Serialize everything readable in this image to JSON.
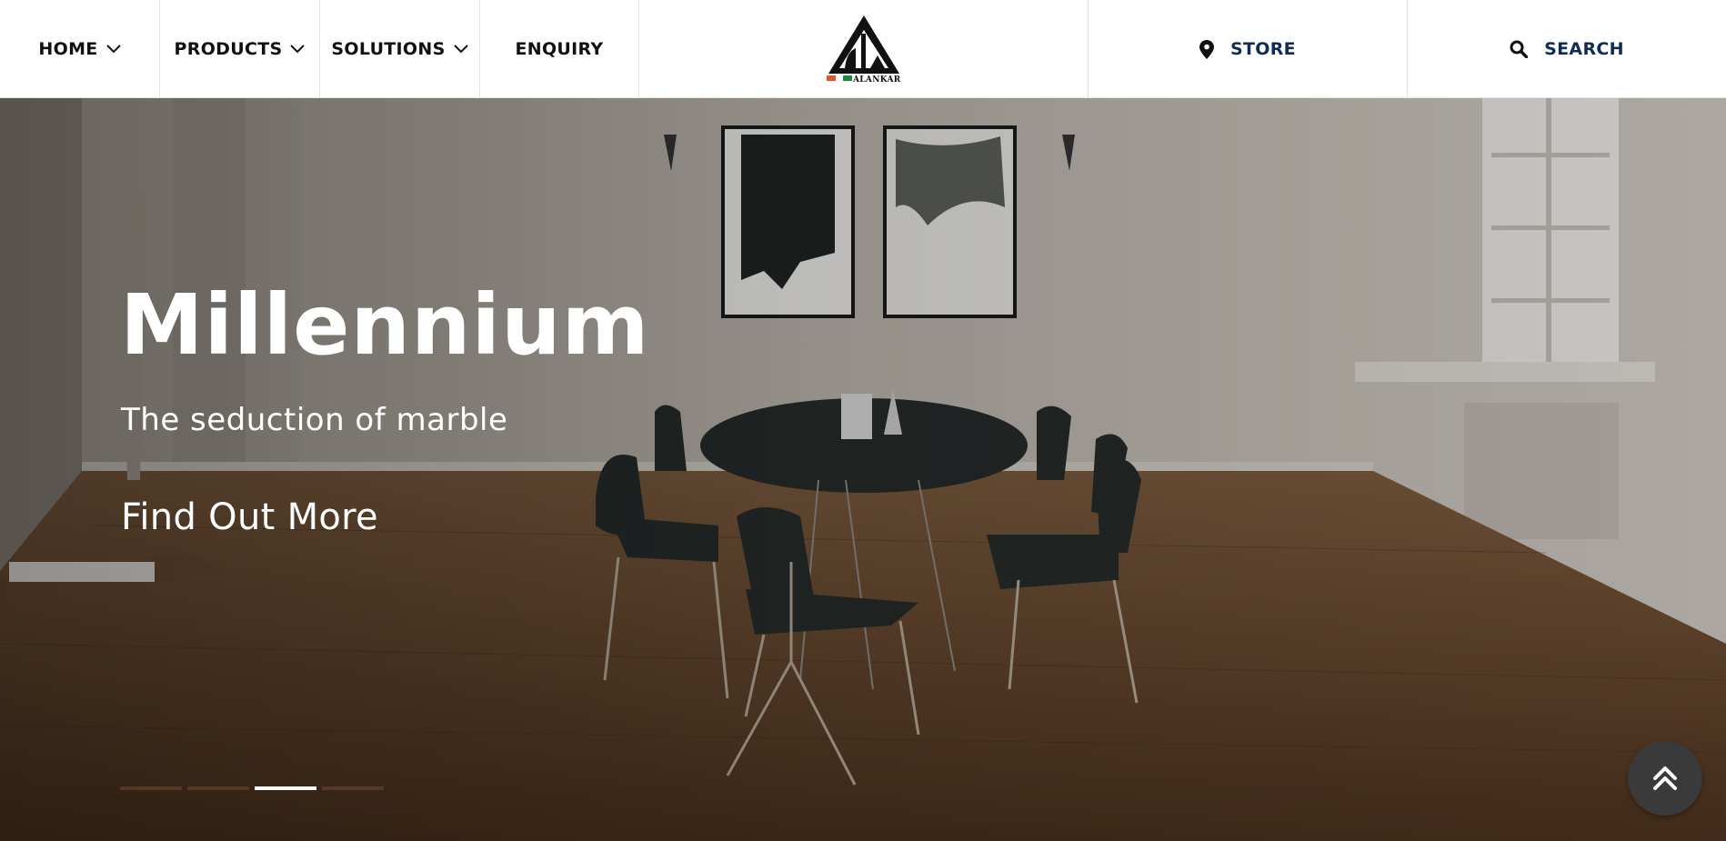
{
  "nav": {
    "home": "HOME",
    "products": "PRODUCTS",
    "solutions": "SOLUTIONS",
    "enquiry": "ENQUIRY",
    "logo_text": "ALANKAR",
    "store": "STORE",
    "search": "SEARCH"
  },
  "hero": {
    "title": "Millennium",
    "subtitle": "The seduction of marble",
    "cta": "Find Out More",
    "slide_count": 4,
    "active_slide": 3
  },
  "colors": {
    "nav_text": "#111111",
    "accent_text": "#0f2b56",
    "logo_orange": "#e0562a",
    "logo_green": "#1f8a3b"
  },
  "icons": [
    "chevron-down-icon",
    "location-pin-icon",
    "search-icon",
    "double-chevron-up-icon"
  ]
}
